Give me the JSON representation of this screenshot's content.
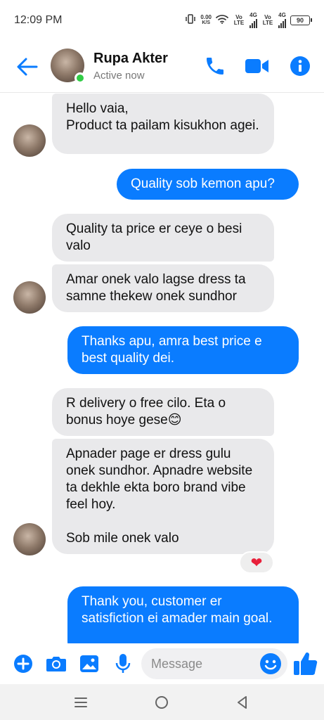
{
  "status_bar": {
    "time": "12:09 PM",
    "net_speed_value": "0.00",
    "net_speed_unit": "K/S",
    "sim1_tag": "Vo LTE",
    "sim1_gen": "4G",
    "sim2_tag": "Vo LTE",
    "sim2_gen": "4G",
    "battery": "90"
  },
  "header": {
    "name": "Rupa Akter",
    "status": "Active now",
    "accent": "#0a7cff",
    "online_color": "#31cc46"
  },
  "messages": [
    {
      "side": "in",
      "text": "Hello vaia,\nProduct ta pailam kisukhon agei."
    },
    {
      "side": "out",
      "text": "Quality sob kemon apu?"
    },
    {
      "side": "in",
      "text": "Quality ta price er ceye o besi valo"
    },
    {
      "side": "in",
      "text": "Amar onek valo lagse dress ta samne thekew onek sundhor"
    },
    {
      "side": "out",
      "text": "Thanks apu, amra best price e best quality dei."
    },
    {
      "side": "in",
      "text": "R delivery o free cilo. Eta o bonus hoye gese😊"
    },
    {
      "side": "in",
      "text": "Apnader page er dress gulu onek sundhor. Apnadre website ta dekhle ekta boro brand vibe feel hoy.\n\nSob mile onek valo"
    },
    {
      "side": "out",
      "text": "Thank you, customer er satisfiction ei amader main goal."
    }
  ],
  "reaction": "❤",
  "composer": {
    "placeholder": "Message"
  }
}
